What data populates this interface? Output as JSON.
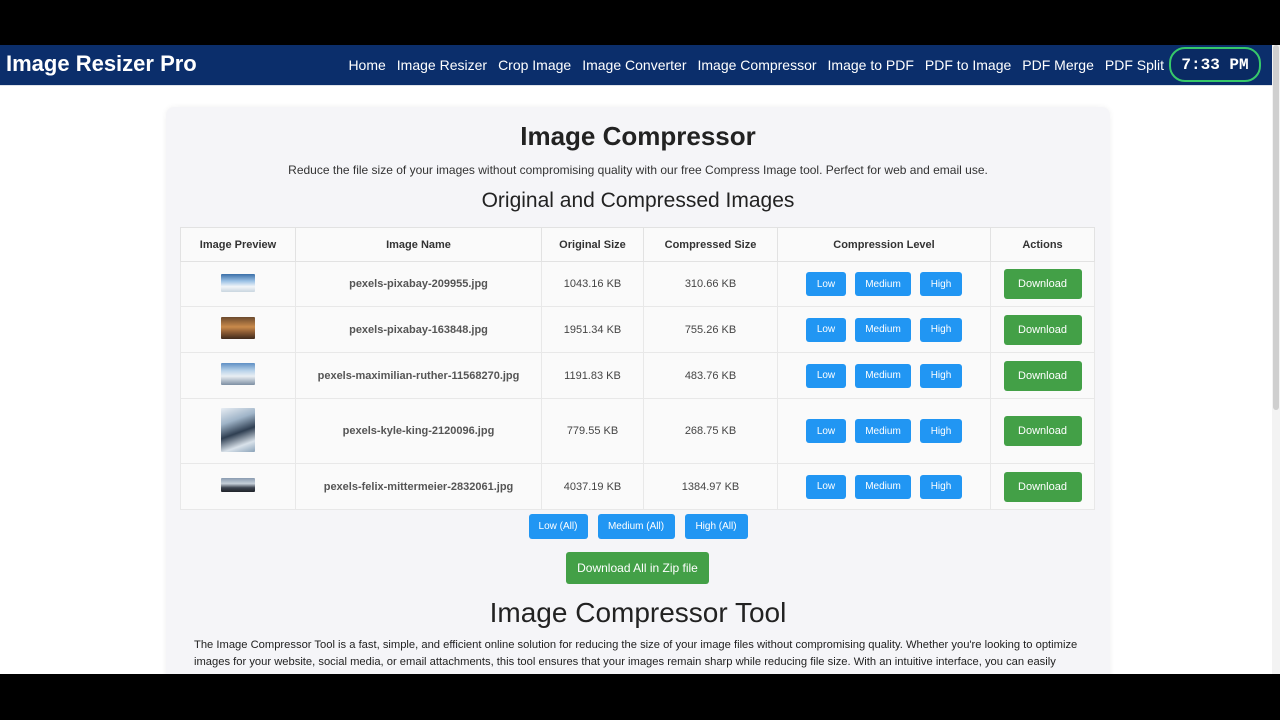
{
  "header": {
    "brand": "Image Resizer Pro",
    "nav": [
      "Home",
      "Image Resizer",
      "Crop Image",
      "Image Converter",
      "Image Compressor",
      "Image to PDF",
      "PDF to Image",
      "PDF Merge",
      "PDF Split"
    ],
    "clock": "7:33 PM"
  },
  "main": {
    "title": "Image Compressor",
    "subtitle": "Reduce the file size of your images without compromising quality with our free Compress Image tool. Perfect for web and email use.",
    "section_title": "Original and Compressed Images",
    "table": {
      "headers": [
        "Image Preview",
        "Image Name",
        "Original Size",
        "Compressed Size",
        "Compression Level",
        "Actions"
      ],
      "level_labels": {
        "low": "Low",
        "medium": "Medium",
        "high": "High"
      },
      "download_label": "Download",
      "rows": [
        {
          "name": "pexels-pixabay-209955.jpg",
          "original": "1043.16 KB",
          "compressed": "310.66 KB"
        },
        {
          "name": "pexels-pixabay-163848.jpg",
          "original": "1951.34 KB",
          "compressed": "755.26 KB"
        },
        {
          "name": "pexels-maximilian-ruther-11568270.jpg",
          "original": "1191.83 KB",
          "compressed": "483.76 KB"
        },
        {
          "name": "pexels-kyle-king-2120096.jpg",
          "original": "779.55 KB",
          "compressed": "268.75 KB"
        },
        {
          "name": "pexels-felix-mittermeier-2832061.jpg",
          "original": "4037.19 KB",
          "compressed": "1384.97 KB"
        }
      ]
    },
    "bulk": {
      "low": "Low (All)",
      "medium": "Medium (All)",
      "high": "High (All)"
    },
    "zip_label": "Download All in Zip file",
    "tool_title": "Image Compressor Tool",
    "tool_text": "The Image Compressor Tool is a fast, simple, and efficient online solution for reducing the size of your image files without compromising quality. Whether you're looking to optimize images for your website, social media, or email attachments, this tool ensures that your images remain sharp while reducing file size. With an intuitive interface, you can easily upload your images, compress them, and download the optimized files."
  },
  "colors": {
    "navbar": "#0b2e6b",
    "accent_blue": "#2196f3",
    "accent_green": "#43a047",
    "clock_border": "#37c86a"
  }
}
